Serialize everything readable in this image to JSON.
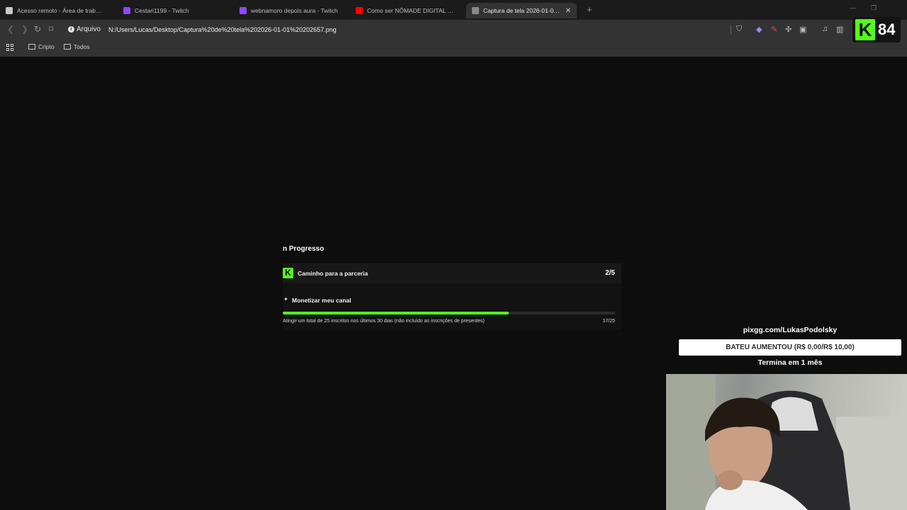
{
  "browser": {
    "tabs": [
      {
        "title": "Acesso remoto - Área de trabalho re",
        "icon": "remote-desktop-icon",
        "color": "#c9c9c9",
        "active": false
      },
      {
        "title": "Cestari1199 - Twitch",
        "icon": "twitch-icon",
        "color": "#9146ff",
        "active": false
      },
      {
        "title": "webnamoro depois aura - Twitch",
        "icon": "twitch-icon",
        "color": "#9146ff",
        "active": false
      },
      {
        "title": "Como ser NÔMADE DIGITAL e progr",
        "icon": "youtube-icon",
        "color": "#ff0000",
        "active": false
      },
      {
        "title": "Captura de tela 2026-01-01 202",
        "icon": "globe-icon",
        "color": "#8a8a8a",
        "active": true
      }
    ],
    "new_tab_label": "+",
    "protocol_label": "Arquivo",
    "url": "N:/Users/Lucas/Desktop/Captura%20de%20tela%202026-01-01%20202657.png",
    "bookmarks": [
      "Cripto",
      "Todos"
    ]
  },
  "kick_counter": {
    "logo": "K",
    "value": "84"
  },
  "progress_card": {
    "heading": "n Progresso",
    "path_logo": "K",
    "path_label": "Caminho para a parceria",
    "path_score": "2/5",
    "spark": "✦",
    "task_label": "Monetizar meu canal",
    "task_description": "Atingir um total de 25 inscritos nos últimos 30 dias (não incluído as inscrições de presentes)",
    "task_count": "17/25",
    "task_progress": 0.68,
    "accent_color": "#53fc18"
  },
  "stream_overlay": {
    "pix_url": "pixgg.com/LukasPodolsky",
    "goal_text": "BATEU AUMENTOU (R$ 0,00/R$ 10,00)",
    "goal_end": "Termina em 1 mês"
  }
}
